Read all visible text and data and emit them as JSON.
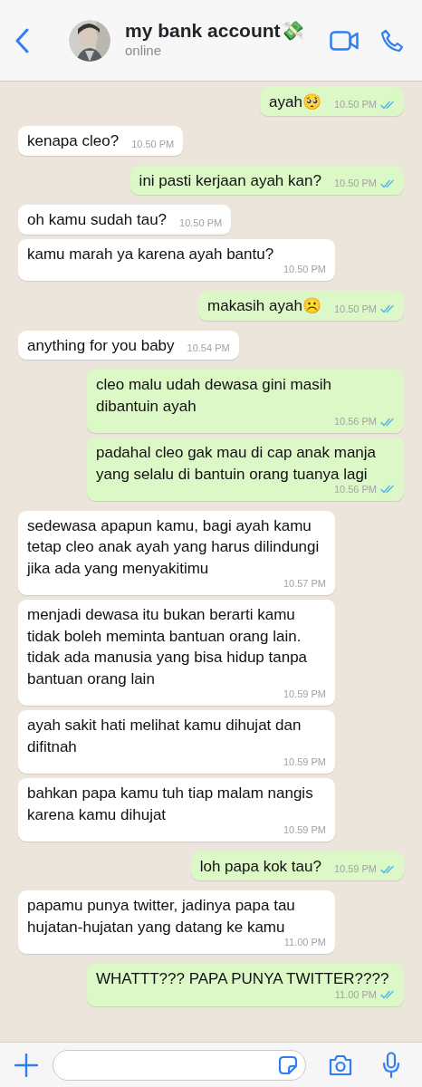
{
  "header": {
    "title": "my bank account💸",
    "status": "online"
  },
  "messages": [
    {
      "kind": "sent",
      "text": "ayah🥺",
      "time": "10.50 PM",
      "read": true
    },
    {
      "kind": "received",
      "text": "kenapa cleo?",
      "time": "10.50 PM"
    },
    {
      "kind": "sent",
      "text": "ini pasti kerjaan ayah kan?",
      "time": "10.50 PM",
      "read": true
    },
    {
      "kind": "received",
      "text": "oh kamu sudah tau?",
      "time": "10.50 PM"
    },
    {
      "kind": "received",
      "text": "kamu marah ya karena ayah bantu?",
      "time": "10.50 PM"
    },
    {
      "kind": "sent",
      "text": "makasih ayah☹️",
      "time": "10.50 PM",
      "read": true
    },
    {
      "kind": "received",
      "text": "anything for you baby",
      "time": "10.54 PM"
    },
    {
      "kind": "sent",
      "text": "cleo malu udah dewasa gini masih dibantuin ayah",
      "time": "10.56 PM",
      "read": true
    },
    {
      "kind": "sent",
      "text": "padahal cleo gak mau di cap anak manja yang selalu di bantuin orang tuanya lagi",
      "time": "10.56 PM",
      "read": true
    },
    {
      "kind": "received",
      "text": "sedewasa apapun kamu, bagi ayah kamu tetap cleo anak ayah yang harus dilindungi jika ada yang menyakitimu",
      "time": "10.57 PM"
    },
    {
      "kind": "received",
      "text": "menjadi dewasa itu bukan berarti kamu tidak boleh meminta bantuan orang lain. tidak ada manusia yang bisa hidup tanpa bantuan orang lain",
      "time": "10.59 PM"
    },
    {
      "kind": "received",
      "text": "ayah sakit hati melihat kamu dihujat dan difitnah",
      "time": "10.59 PM"
    },
    {
      "kind": "received",
      "text": "bahkan papa kamu tuh tiap malam nangis karena kamu dihujat",
      "time": "10.59 PM"
    },
    {
      "kind": "sent",
      "text": "loh papa kok tau?",
      "time": "10.59 PM",
      "read": true
    },
    {
      "kind": "received",
      "text": "papamu punya twitter, jadinya papa tau hujatan-hujatan yang datang ke kamu",
      "time": "11.00 PM"
    },
    {
      "kind": "sent",
      "text": "WHATTT??? PAPA PUNYA TWITTER????",
      "time": "11.00 PM",
      "read": true
    }
  ]
}
